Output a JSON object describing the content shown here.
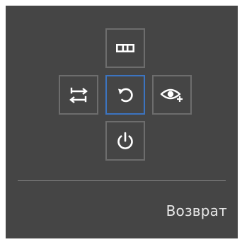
{
  "osd": {
    "background_color": "#454545",
    "border_color": "#6d6d6d",
    "selected_border_color": "#3c74c0",
    "icon_color": "#ffffff",
    "buttons": [
      {
        "position": "up",
        "icon": "menu-grid-icon",
        "selected": false
      },
      {
        "position": "left",
        "icon": "switch-arrows-icon",
        "selected": false
      },
      {
        "position": "center",
        "icon": "return-arrow-icon",
        "selected": true
      },
      {
        "position": "right",
        "icon": "eye-saver-icon",
        "selected": false
      },
      {
        "position": "down",
        "icon": "power-icon",
        "selected": false
      }
    ],
    "action_label": "Возврат"
  }
}
